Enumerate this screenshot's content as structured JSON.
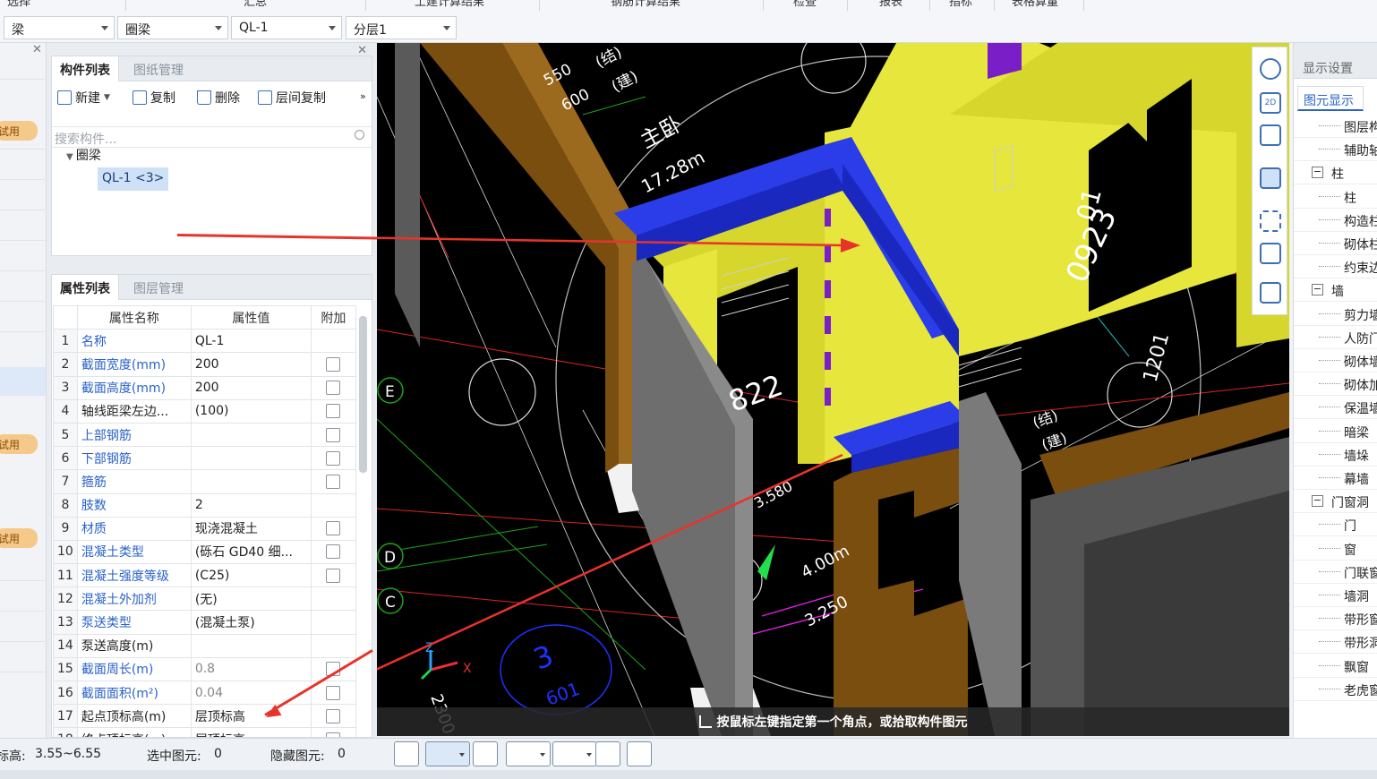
{
  "top_tabs": [
    "选择",
    "汇总",
    "土建计算结果",
    "钢筋计算结果",
    "检查",
    "报表",
    "指标",
    "表格算量"
  ],
  "selectors": [
    {
      "value": "梁"
    },
    {
      "value": "圈梁"
    },
    {
      "value": "QL-1"
    },
    {
      "value": "分层1"
    }
  ],
  "left_strip": {
    "trial_label": "试用"
  },
  "component_panel": {
    "tabs": [
      "构件列表",
      "图纸管理"
    ],
    "toolbar": {
      "new": "新建",
      "copy": "复制",
      "delete": "删除",
      "floor_copy": "层间复制",
      "more": "»"
    },
    "search_placeholder": "搜索构件...",
    "tree": {
      "group": "圈梁",
      "item": "QL-1 <3>"
    }
  },
  "property_panel": {
    "tabs": [
      "属性列表",
      "图层管理"
    ],
    "headers": {
      "name": "属性名称",
      "value": "属性值",
      "extra": "附加"
    },
    "rows": [
      {
        "no": "1",
        "name": "名称",
        "value": "QL-1",
        "link": true,
        "checkbox": false
      },
      {
        "no": "2",
        "name": "截面宽度(mm)",
        "value": "200",
        "link": true,
        "checkbox": true
      },
      {
        "no": "3",
        "name": "截面高度(mm)",
        "value": "200",
        "link": true,
        "checkbox": true
      },
      {
        "no": "4",
        "name": "轴线距梁左边...",
        "value": "(100)",
        "link": false,
        "checkbox": true
      },
      {
        "no": "5",
        "name": "上部钢筋",
        "value": "",
        "link": true,
        "checkbox": true
      },
      {
        "no": "6",
        "name": "下部钢筋",
        "value": "",
        "link": true,
        "checkbox": true
      },
      {
        "no": "7",
        "name": "箍筋",
        "value": "",
        "link": true,
        "checkbox": true
      },
      {
        "no": "8",
        "name": "肢数",
        "value": "2",
        "link": true,
        "checkbox": false
      },
      {
        "no": "9",
        "name": "材质",
        "value": "现浇混凝土",
        "link": true,
        "checkbox": true
      },
      {
        "no": "10",
        "name": "混凝土类型",
        "value": "(砾石 GD40 细...",
        "link": true,
        "checkbox": true
      },
      {
        "no": "11",
        "name": "混凝土强度等级",
        "value": "(C25)",
        "link": true,
        "checkbox": true
      },
      {
        "no": "12",
        "name": "混凝土外加剂",
        "value": "(无)",
        "link": true,
        "checkbox": false
      },
      {
        "no": "13",
        "name": "泵送类型",
        "value": "(混凝土泵)",
        "link": true,
        "checkbox": false
      },
      {
        "no": "14",
        "name": "泵送高度(m)",
        "value": "",
        "link": false,
        "checkbox": false
      },
      {
        "no": "15",
        "name": "截面周长(m)",
        "value": "0.8",
        "link": true,
        "checkbox": true,
        "grey": true
      },
      {
        "no": "16",
        "name": "截面面积(m²)",
        "value": "0.04",
        "link": true,
        "checkbox": true,
        "grey": true
      },
      {
        "no": "17",
        "name": "起点顶标高(m)",
        "value": "层顶标高",
        "link": false,
        "checkbox": true
      },
      {
        "no": "18",
        "name": "终点顶标高(m)",
        "value": "层顶标高",
        "link": false,
        "checkbox": true
      }
    ]
  },
  "viewport": {
    "axis_labels": [
      "E",
      "D",
      "C"
    ],
    "drawing_texts": [
      "550",
      "600",
      "(结)",
      "(建)",
      "主卧",
      "17.28m",
      "0923",
      "822",
      "3.580",
      "4.00m",
      "3.250",
      "2300",
      "3",
      "601",
      "1201",
      "01",
      "(结)",
      "(建)"
    ],
    "command_hint": "按鼠标左键指定第一个角点，或拾取构件图元",
    "axes": {
      "x": "X",
      "z": "Z"
    }
  },
  "display_panel": {
    "title": "显示设置",
    "tab": "图元显示",
    "items": [
      {
        "label": "图层构",
        "level": 1
      },
      {
        "label": "辅助轴",
        "level": 1
      },
      {
        "label": "柱",
        "level": 0,
        "toggle": "−"
      },
      {
        "label": "柱",
        "level": 1
      },
      {
        "label": "构造柱",
        "level": 1
      },
      {
        "label": "砌体柱",
        "level": 1
      },
      {
        "label": "约束边",
        "level": 1
      },
      {
        "label": "墙",
        "level": 0,
        "toggle": "−"
      },
      {
        "label": "剪力墙",
        "level": 1
      },
      {
        "label": "人防门",
        "level": 1
      },
      {
        "label": "砌体墙",
        "level": 1
      },
      {
        "label": "砌体加",
        "level": 1
      },
      {
        "label": "保温墙",
        "level": 1
      },
      {
        "label": "暗梁",
        "level": 1
      },
      {
        "label": "墙垛",
        "level": 1
      },
      {
        "label": "幕墙",
        "level": 1
      },
      {
        "label": "门窗洞",
        "level": 0,
        "toggle": "−"
      },
      {
        "label": "门",
        "level": 1
      },
      {
        "label": "窗",
        "level": 1
      },
      {
        "label": "门联窗",
        "level": 1
      },
      {
        "label": "墙洞",
        "level": 1
      },
      {
        "label": "带形窗",
        "level": 1
      },
      {
        "label": "带形洞",
        "level": 1
      },
      {
        "label": "飘窗",
        "level": 1
      },
      {
        "label": "老虎窗",
        "level": 1
      }
    ]
  },
  "status_bar": {
    "elevation_label": "标高:",
    "elevation_value": "3.55~6.55",
    "selected_label": "选中图元:",
    "selected_value": "0",
    "hidden_label": "隐藏图元:",
    "hidden_value": "0"
  },
  "colors": {
    "accent": "#2a62c9",
    "trial_badge": "#f5c98a",
    "ring_beam": "#1f2fd8",
    "wall_yellow": "#e6e63c",
    "wall_brown": "#7a4e0f",
    "wall_grey": "#6e6e6e",
    "annotation_arrow": "#e8332a"
  }
}
